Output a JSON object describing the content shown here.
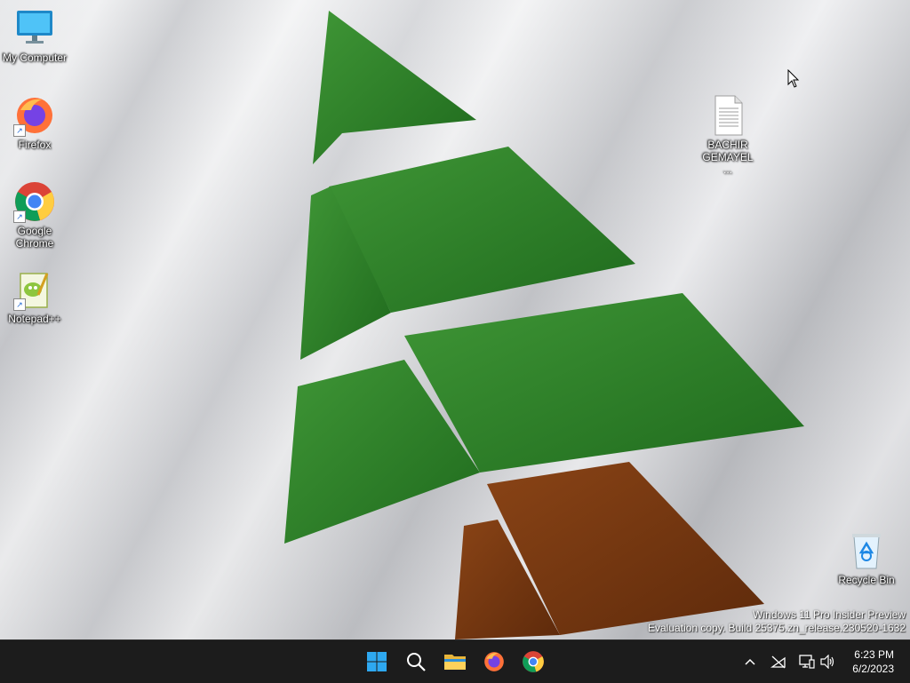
{
  "desktop": {
    "icons": [
      {
        "label": "My Computer",
        "icon": "monitor-icon"
      },
      {
        "label": "Firefox",
        "icon": "firefox-icon"
      },
      {
        "label": "Google Chrome",
        "icon": "chrome-icon"
      },
      {
        "label": "Notepad++",
        "icon": "notepadpp-icon"
      },
      {
        "label": "BACHIR GEMAYEL ...",
        "icon": "text-document-icon"
      },
      {
        "label": "Recycle Bin",
        "icon": "recycle-bin-icon"
      }
    ],
    "watermark": {
      "line1": "Windows 11 Pro Insider Preview",
      "line2": "Evaluation copy. Build 25375.zn_release.230520-1632"
    },
    "wallpaper_colors": {
      "green": "#2f7d2a",
      "brown": "#7a3a12",
      "white": "#f2f2f2"
    }
  },
  "taskbar": {
    "apps": [
      {
        "name": "Start",
        "icon": "windows-start-icon"
      },
      {
        "name": "Search",
        "icon": "search-icon"
      },
      {
        "name": "File Explorer",
        "icon": "folder-icon"
      },
      {
        "name": "Firefox",
        "icon": "firefox-icon"
      },
      {
        "name": "Google Chrome",
        "icon": "chrome-icon"
      }
    ],
    "tray": {
      "icons": [
        "chevron-up-icon",
        "network-off-icon",
        "display-icon",
        "volume-icon"
      ],
      "time": "6:23 PM",
      "date": "6/2/2023"
    },
    "background": "#1c1c1c"
  }
}
